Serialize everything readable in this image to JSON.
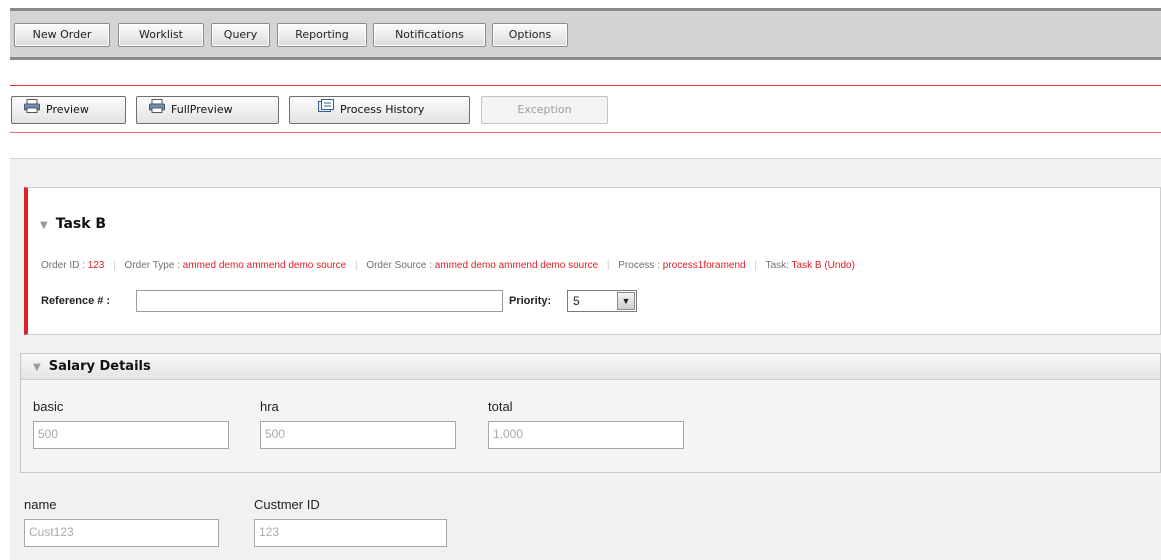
{
  "nav": {
    "items": [
      "New Order",
      "Worklist",
      "Query",
      "Reporting",
      "Notifications",
      "Options"
    ]
  },
  "toolbar": {
    "preview": "Preview",
    "full_preview": "FullPreview",
    "process_history": "Process History",
    "exception": "Exception"
  },
  "task": {
    "title": "Task B",
    "info": {
      "order_id_label": "Order ID :",
      "order_id": "123",
      "order_type_label": "Order Type :",
      "order_type": "ammed demo ammend demo source",
      "order_source_label": "Order Source :",
      "order_source": "ammed demo ammend demo source",
      "process_label": "Process :",
      "process": "process1foramend",
      "task_label": "Task:",
      "task": "Task B",
      "undo": "(Undo)"
    },
    "reference_label": "Reference # :",
    "reference_value": "",
    "priority_label": "Priority:",
    "priority_value": "5"
  },
  "salary": {
    "title": "Salary Details",
    "basic_label": "basic",
    "basic_value": "500",
    "hra_label": "hra",
    "hra_value": "500",
    "total_label": "total",
    "total_value": "1,000"
  },
  "customer": {
    "name_label": "name",
    "name_value": "Cust123",
    "id_label": "Custmer ID",
    "id_value": "123"
  },
  "colors": {
    "accent_red": "#e21d24",
    "nav_bg": "#d4d4d4"
  }
}
